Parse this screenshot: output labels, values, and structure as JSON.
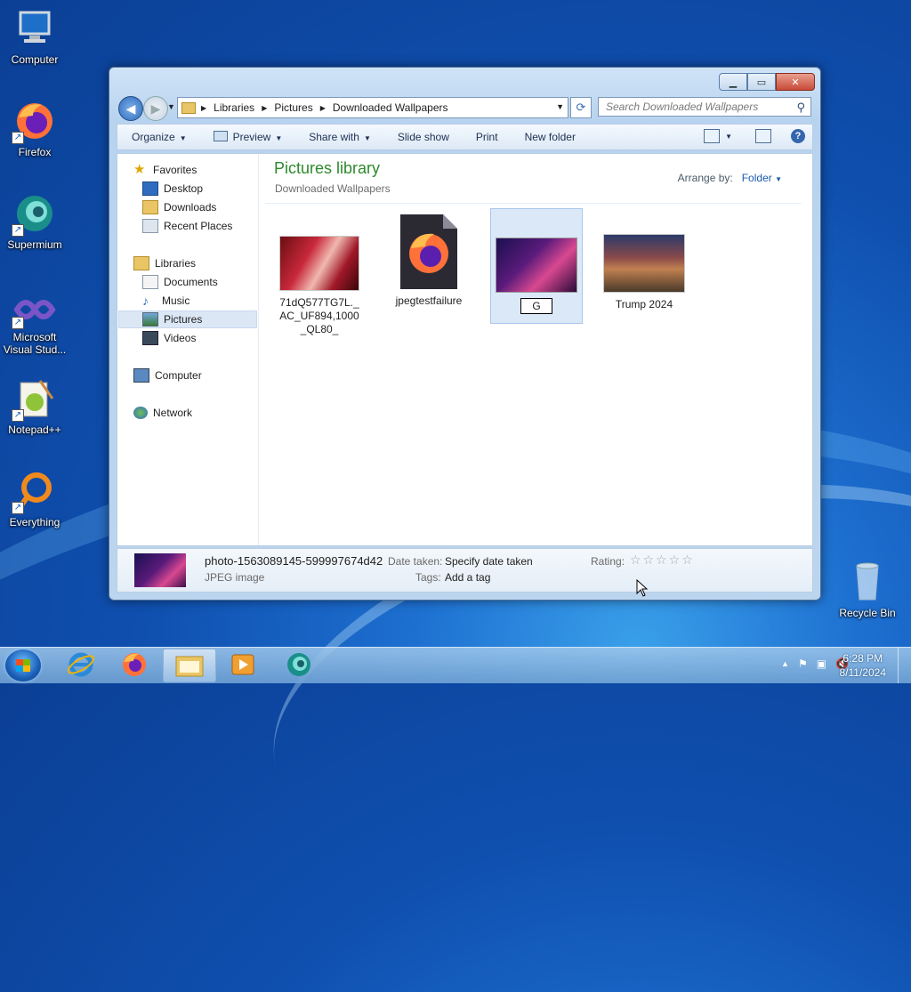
{
  "desktop": {
    "icons": [
      {
        "label": "Computer"
      },
      {
        "label": "Firefox"
      },
      {
        "label": "Supermium"
      },
      {
        "label": "Microsoft Visual Stud..."
      },
      {
        "label": "Notepad++"
      },
      {
        "label": "Everything"
      },
      {
        "label": "Recycle Bin"
      }
    ]
  },
  "window": {
    "breadcrumb": [
      "Libraries",
      "Pictures",
      "Downloaded Wallpapers"
    ],
    "search_placeholder": "Search Downloaded Wallpapers",
    "toolbar": {
      "organize": "Organize",
      "preview": "Preview",
      "share_with": "Share with",
      "slide_show": "Slide show",
      "print": "Print",
      "new_folder": "New folder"
    },
    "nav": {
      "favorites": "Favorites",
      "desktop": "Desktop",
      "downloads": "Downloads",
      "recent_places": "Recent Places",
      "libraries": "Libraries",
      "documents": "Documents",
      "music": "Music",
      "pictures": "Pictures",
      "videos": "Videos",
      "computer": "Computer",
      "network": "Network"
    },
    "library_title": "Pictures library",
    "library_subtitle": "Downloaded Wallpapers",
    "arrange_label": "Arrange by:",
    "arrange_value": "Folder",
    "files": [
      {
        "name": "71dQ577TG7L._AC_UF894,1000_QL80_"
      },
      {
        "name": "jpegtestfailure"
      },
      {
        "name": "G",
        "renaming": true
      },
      {
        "name": "Trump 2024"
      }
    ],
    "details": {
      "filename": "photo-1563089145-599997674d42",
      "type": "JPEG image",
      "date_label": "Date taken:",
      "date_value": "Specify date taken",
      "tags_label": "Tags:",
      "tags_value": "Add a tag",
      "rating_label": "Rating:"
    }
  },
  "taskbar": {
    "time": "6:28 PM",
    "date": "8/11/2024"
  },
  "colors": {
    "library_title": "#2d8a2d",
    "link_blue": "#1a5bb0",
    "selection": "#dbe8f8"
  }
}
